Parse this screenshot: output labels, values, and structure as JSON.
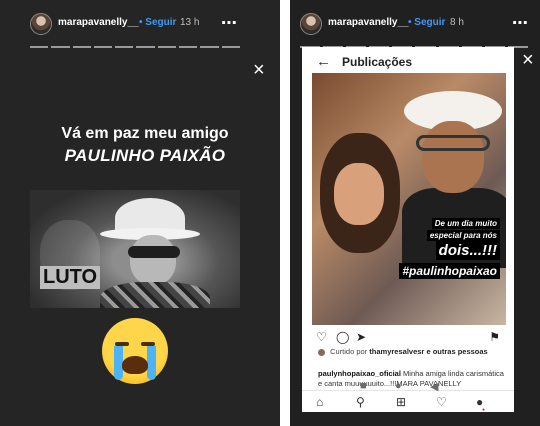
{
  "left_story": {
    "username": "marapavanelly__",
    "follow": "• Seguir",
    "time": "13 h",
    "more_icon": "⋯",
    "close_icon": "×",
    "caption_line1": "Vá em paz meu amigo",
    "caption_line2": "PAULINHO PAIXÃO",
    "photo_text": "LUTO",
    "emoji": "loudly-crying-face"
  },
  "right_story": {
    "username": "marapavanelly__",
    "follow": "• Seguir",
    "time": "8 h",
    "more_icon": "⋯",
    "close_icon": "×",
    "screen_title": "Publicações",
    "back_icon": "←",
    "photo_overlay": {
      "line1": "De um dia muito",
      "line2": "especial para nós",
      "line3": "dois...!!!",
      "line4": "#paulinhopaixao"
    },
    "liked_by": {
      "prefix": "Curtido por",
      "user": "thamyresalvesr",
      "suffix": "e outras pessoas"
    },
    "post_caption": {
      "user": "paulynhopaixao_oficial",
      "text": "Minha amiga linda carismática e canta muuuuuuito...!!!MARA PAVANELLY"
    },
    "nav_icons": [
      "home-icon",
      "search-icon",
      "add-icon",
      "heart-icon",
      "profile-icon"
    ],
    "system_icons": [
      "recent-apps-icon",
      "home-button-icon",
      "back-button-icon"
    ]
  },
  "colors": {
    "story_bg": "#252525",
    "follow_blue": "#3f9af5",
    "screen_bg": "#ffffff"
  }
}
